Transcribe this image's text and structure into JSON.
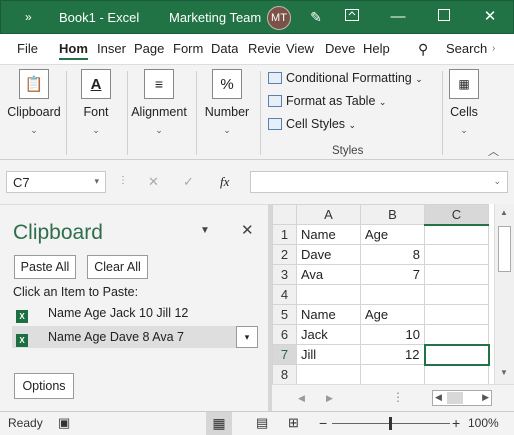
{
  "titlebar": {
    "quick_access": "»",
    "doc_title": "Book1 - Excel",
    "team": "Marketing Team",
    "avatar_initials": "MT",
    "accent": "#217346"
  },
  "tabs": [
    "File",
    "Hom",
    "Inser",
    "Page",
    "Form",
    "Data",
    "Revie",
    "View",
    "Deve",
    "Help"
  ],
  "search_label": "Search",
  "ribbon": {
    "clipboard": "Clipboard",
    "font": "Font",
    "alignment": "Alignment",
    "number": "Number",
    "number_icon": "%",
    "cond_format": "Conditional Formatting",
    "format_table": "Format as Table",
    "cell_styles": "Cell Styles",
    "styles_group": "Styles",
    "cells": "Cells"
  },
  "formula_bar": {
    "name_box": "C7",
    "fx": "fx",
    "formula": ""
  },
  "clipboard_pane": {
    "title": "Clipboard",
    "paste_all": "Paste All",
    "clear_all": "Clear All",
    "instruction": "Click an Item to Paste:",
    "items": [
      "Name Age Jack 10 Jill 12",
      "Name Age Dave 8 Ava 7"
    ],
    "options": "Options"
  },
  "sheet": {
    "columns": [
      "A",
      "B",
      "C"
    ],
    "rows": [
      {
        "num": "1",
        "a": "Name",
        "b": "Age",
        "c": ""
      },
      {
        "num": "2",
        "a": "Dave",
        "b": "8",
        "c": ""
      },
      {
        "num": "3",
        "a": "Ava",
        "b": "7",
        "c": ""
      },
      {
        "num": "4",
        "a": "",
        "b": "",
        "c": ""
      },
      {
        "num": "5",
        "a": "Name",
        "b": "Age",
        "c": ""
      },
      {
        "num": "6",
        "a": "Jack",
        "b": "10",
        "c": ""
      },
      {
        "num": "7",
        "a": "Jill",
        "b": "12",
        "c": ""
      },
      {
        "num": "8",
        "a": "",
        "b": "",
        "c": ""
      }
    ]
  },
  "status": {
    "ready": "Ready",
    "zoom": "100%"
  }
}
